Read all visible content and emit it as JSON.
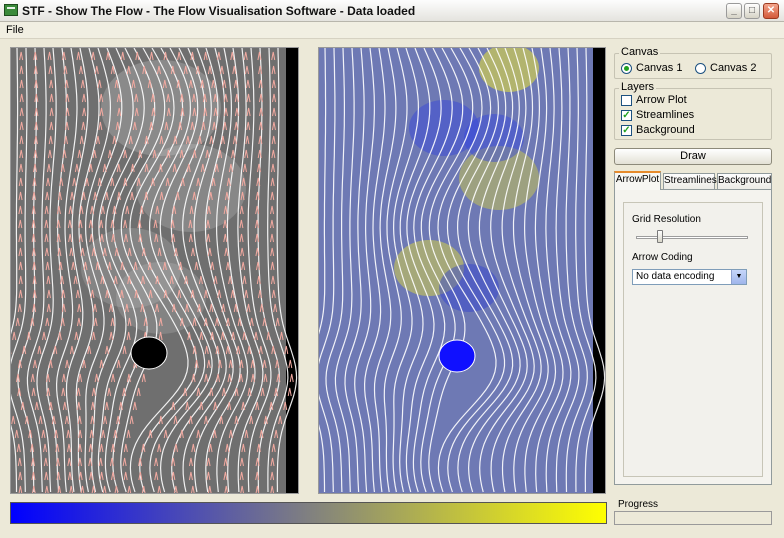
{
  "window": {
    "title": "STF - Show The Flow - The Flow Visualisation Software - Data loaded",
    "minimize": "_",
    "maximize": "□",
    "close": "✕"
  },
  "menu": {
    "items": [
      "File"
    ]
  },
  "canvas_group": {
    "label": "Canvas",
    "options": [
      {
        "label": "Canvas 1",
        "selected": true
      },
      {
        "label": "Canvas 2",
        "selected": false
      }
    ]
  },
  "layers_group": {
    "label": "Layers",
    "items": [
      {
        "label": "Arrow Plot",
        "checked": false
      },
      {
        "label": "Streamlines",
        "checked": true
      },
      {
        "label": "Background",
        "checked": true
      }
    ]
  },
  "draw_button": "Draw",
  "tabs": [
    {
      "label": "ArrowPlot",
      "active": true
    },
    {
      "label": "Streamlines",
      "active": false
    },
    {
      "label": "Background",
      "active": false
    }
  ],
  "arrowplot": {
    "grid_resolution_label": "Grid Resolution",
    "grid_resolution_value": 0.25,
    "arrow_coding_label": "Arrow Coding",
    "arrow_coding_value": "No data encoding"
  },
  "progress": {
    "label": "Progress",
    "value": 0
  },
  "colors": {
    "colormap_low": "#0000FF",
    "colormap_mid": "#808080",
    "colormap_high": "#FFFF00",
    "streamline": "#FFFFFF",
    "arrow": "#F2A9A0"
  }
}
